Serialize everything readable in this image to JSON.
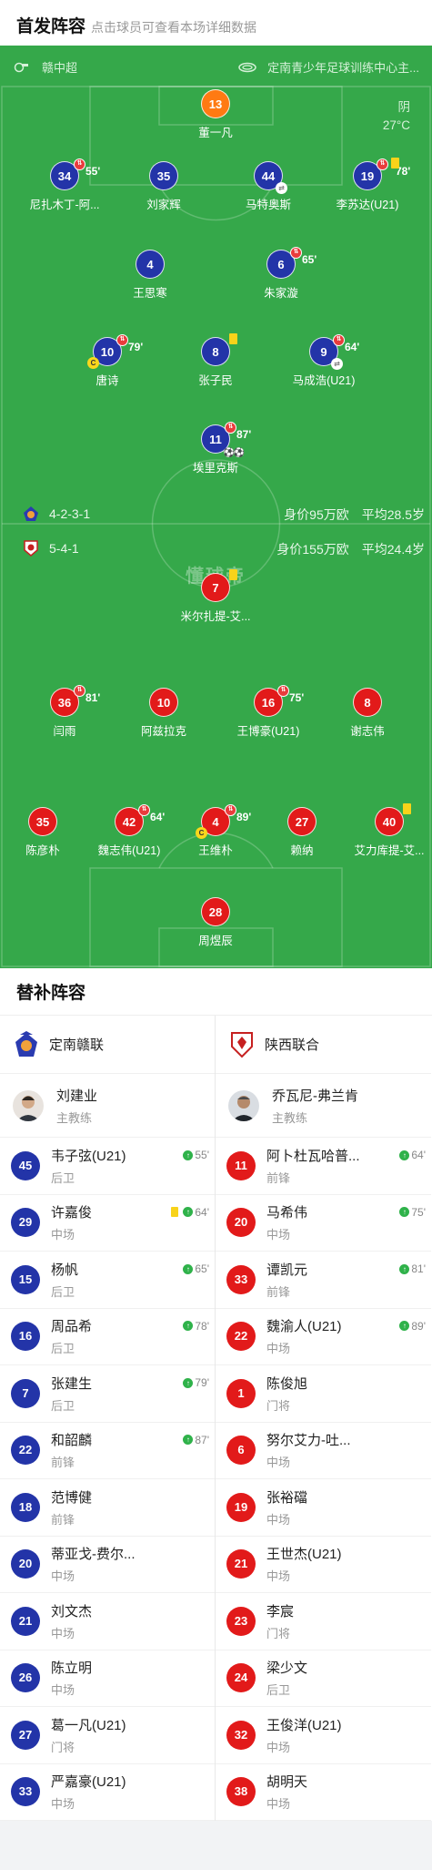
{
  "header": {
    "title": "首发阵容",
    "subtitle": "点击球员可查看本场详细数据"
  },
  "match_info": {
    "league": "赣中超",
    "venue": "定南青少年足球训练中心主...",
    "weather": "阴",
    "temperature": "27°C"
  },
  "home": {
    "formation": "4-2-3-1",
    "value": "身价95万欧",
    "avg_age": "平均28.5岁",
    "color": "#2334a8",
    "players": [
      {
        "number": "13",
        "name": "董一凡",
        "gk": true
      },
      {
        "number": "34",
        "name": "尼扎木丁-阿...",
        "sub_time": "55'"
      },
      {
        "number": "35",
        "name": "刘家辉"
      },
      {
        "number": "44",
        "name": "马特奥斯",
        "swap": true
      },
      {
        "number": "19",
        "name": "李苏达(U21)",
        "yellow": true,
        "sub_time": "78'"
      },
      {
        "number": "4",
        "name": "王思寒"
      },
      {
        "number": "6",
        "name": "朱家漩",
        "sub_time": "65'"
      },
      {
        "number": "10",
        "name": "唐诗",
        "captain": true,
        "sub_time": "79'"
      },
      {
        "number": "8",
        "name": "张子民",
        "yellow": true
      },
      {
        "number": "9",
        "name": "马成浩(U21)",
        "swap": true,
        "sub_time": "64'"
      },
      {
        "number": "11",
        "name": "埃里克斯",
        "goals": 2,
        "sub_time": "87'"
      }
    ]
  },
  "away": {
    "formation": "5-4-1",
    "value": "身价155万欧",
    "avg_age": "平均24.4岁",
    "color": "#e21a1a",
    "players": [
      {
        "number": "7",
        "name": "米尔扎提-艾...",
        "yellow": true
      },
      {
        "number": "36",
        "name": "闫雨",
        "sub_time": "81'"
      },
      {
        "number": "10",
        "name": "阿兹拉克"
      },
      {
        "number": "16",
        "name": "王博豪(U21)",
        "sub_time": "75'"
      },
      {
        "number": "8",
        "name": "谢志伟"
      },
      {
        "number": "35",
        "name": "陈彦朴"
      },
      {
        "number": "42",
        "name": "魏志伟(U21)",
        "sub_time": "64'"
      },
      {
        "number": "4",
        "name": "王维朴",
        "captain": true,
        "sub_time": "89'"
      },
      {
        "number": "27",
        "name": "赖纳"
      },
      {
        "number": "40",
        "name": "艾力库提-艾...",
        "yellow": true
      },
      {
        "number": "28",
        "name": "周煜辰",
        "gk": true
      }
    ]
  },
  "watermark": "懂球帝",
  "bench": {
    "title": "替补阵容",
    "home_team": "定南赣联",
    "away_team": "陕西联合",
    "home_coach": {
      "name": "刘建业",
      "role": "主教练"
    },
    "away_coach": {
      "name": "乔瓦尼-弗兰肯",
      "role": "主教练"
    },
    "home_players": [
      {
        "number": "45",
        "name": "韦子弦(U21)",
        "pos": "后卫",
        "in": "55'"
      },
      {
        "number": "29",
        "name": "许嘉俊",
        "pos": "中场",
        "in": "64'",
        "yellow": true
      },
      {
        "number": "15",
        "name": "杨帆",
        "pos": "后卫",
        "in": "65'"
      },
      {
        "number": "16",
        "name": "周品希",
        "pos": "后卫",
        "in": "78'"
      },
      {
        "number": "7",
        "name": "张建生",
        "pos": "后卫",
        "in": "79'"
      },
      {
        "number": "22",
        "name": "和韶麟",
        "pos": "前锋",
        "in": "87'"
      },
      {
        "number": "18",
        "name": "范博健",
        "pos": "前锋"
      },
      {
        "number": "20",
        "name": "蒂亚戈-费尔...",
        "pos": "中场"
      },
      {
        "number": "21",
        "name": "刘文杰",
        "pos": "中场"
      },
      {
        "number": "26",
        "name": "陈立明",
        "pos": "中场"
      },
      {
        "number": "27",
        "name": "葛一凡(U21)",
        "pos": "门将"
      },
      {
        "number": "33",
        "name": "严嘉豪(U21)",
        "pos": "中场"
      }
    ],
    "away_players": [
      {
        "number": "11",
        "name": "阿卜杜瓦哈普...",
        "pos": "前锋",
        "in": "64'"
      },
      {
        "number": "20",
        "name": "马希伟",
        "pos": "中场",
        "in": "75'"
      },
      {
        "number": "33",
        "name": "谭凯元",
        "pos": "前锋",
        "in": "81'"
      },
      {
        "number": "22",
        "name": "魏渝人(U21)",
        "pos": "中场",
        "in": "89'"
      },
      {
        "number": "1",
        "name": "陈俊旭",
        "pos": "门将"
      },
      {
        "number": "6",
        "name": "努尔艾力-吐...",
        "pos": "中场"
      },
      {
        "number": "19",
        "name": "张裕礑",
        "pos": "中场"
      },
      {
        "number": "21",
        "name": "王世杰(U21)",
        "pos": "中场"
      },
      {
        "number": "23",
        "name": "李宸",
        "pos": "门将"
      },
      {
        "number": "24",
        "name": "梁少文",
        "pos": "后卫"
      },
      {
        "number": "32",
        "name": "王俊洋(U21)",
        "pos": "中场"
      },
      {
        "number": "38",
        "name": "胡明天",
        "pos": "中场"
      }
    ]
  }
}
